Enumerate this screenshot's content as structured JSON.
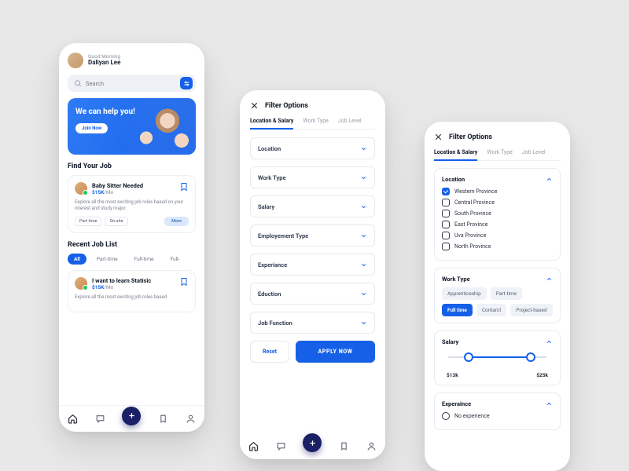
{
  "home": {
    "greeting": "Good Morning",
    "user_name": "Daliyan Lee",
    "search_placeholder": "Search",
    "hero_title": "We can help you!",
    "hero_cta": "Join Now",
    "find_title": "Find Your Job",
    "job1": {
      "title": "Baby Sitter Needed",
      "salary": "$15K",
      "per": "/Mo",
      "desc": "Explore all the most exciting job roles based on your interest and study major.",
      "tag1": "Part time",
      "tag2": "On site",
      "more": "More"
    },
    "recent_title": "Recent Job List",
    "pills": {
      "all": "All",
      "pt": "Part-time",
      "ft": "Full-time",
      "f": "Full-"
    },
    "job2": {
      "title": "I want to learn Statisic",
      "salary": "$15K",
      "per": "/Mo",
      "desc": "Explore all the most exciting job roles based"
    }
  },
  "filter": {
    "title": "Filter Options",
    "tabs": {
      "t1": "Location & Salary",
      "t2": "Work Type",
      "t3": "Job Level"
    },
    "dd": {
      "loc": "Location",
      "wt": "Work Type",
      "sal": "Salary",
      "emp": "Employement Type",
      "exp": "Experiance",
      "edu": "Eduction",
      "jf": "Job Function"
    },
    "reset": "Reset",
    "apply": "APPLY NOW"
  },
  "filter2": {
    "loc_title": "Location",
    "locs": {
      "l1": "Western Province",
      "l2": "Central Province",
      "l3": "South Province",
      "l4": "East Province",
      "l5": "Uva Province",
      "l6": "North Province"
    },
    "wt_title": "Work Type",
    "wt": {
      "w1": "Apprenticeship",
      "w2": "Part-time",
      "w3": "Full time",
      "w4": "Contarct",
      "w5": "Project-based"
    },
    "sal_title": "Salary",
    "sal_min": "$13k",
    "sal_max": "$25k",
    "exp_title": "Experaince",
    "exp1": "No experience"
  }
}
